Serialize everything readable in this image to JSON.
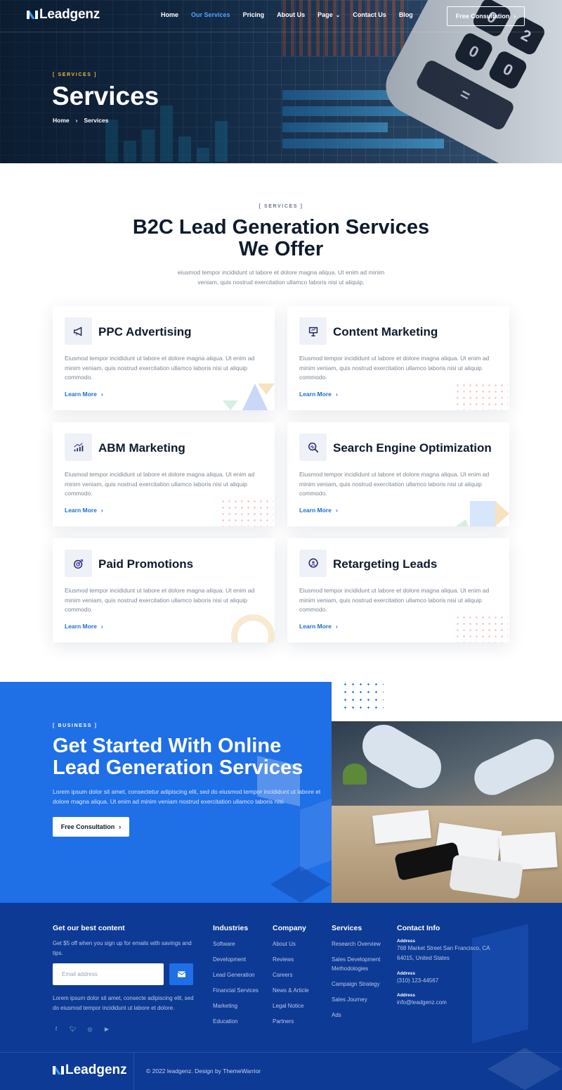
{
  "brand": {
    "logo_text": "Leadgenz"
  },
  "nav": {
    "links": [
      "Home",
      "Our Services",
      "Pricing",
      "About Us",
      "Page",
      "Contact Us",
      "Blog"
    ],
    "active": "Our Services",
    "cta": "Free Consultation"
  },
  "hero": {
    "tag": "[ SERVICES ]",
    "title": "Services",
    "breadcrumb": [
      "Home",
      "Services"
    ]
  },
  "services_section": {
    "tag": "[ SERVICES ]",
    "title_line1": "B2C Lead Generation Services",
    "title_line2": "We Offer",
    "description": "eiusmod tempor incididunt ut labore et dolore magna aliqua. Ut enim ad minim veniam, quis nostrud exercitation ullamco laboris nisi ut aliquip.",
    "cards": [
      {
        "title": "PPC Advertising",
        "icon": "megaphone-icon",
        "text": "Eiusmod tempor incididunt ut labore et dolore magna aliqua. Ut enim ad minim veniam, quis nostrud exercitation ullamco laboris nisi ut aliquip commodo.",
        "link": "Learn More"
      },
      {
        "title": "Content Marketing",
        "icon": "presentation-icon",
        "text": "Eiusmod tempor incididunt ut labore et dolore magna aliqua. Ut enim ad minim veniam, quis nostrud exercitation ullamco laboris nisi ut aliquip commodo.",
        "link": "Learn More"
      },
      {
        "title": "ABM Marketing",
        "icon": "growth-chart-icon",
        "text": "Eiusmod tempor incididunt ut labore et dolore magna aliqua. Ut enim ad minim veniam, quis nostrud exercitation ullamco laboris nisi ut aliquip commodo.",
        "link": "Learn More"
      },
      {
        "title": "Search Engine Optimization",
        "icon": "magnifier-pulse-icon",
        "text": "Eiusmod tempor incididunt ut labore et dolore magna aliqua. Ut enim ad minim veniam, quis nostrud exercitation ullamco laboris nisi ut aliquip commodo.",
        "link": "Learn More"
      },
      {
        "title": "Paid Promotions",
        "icon": "target-icon",
        "text": "Eiusmod tempor incididunt ut labore et dolore magna aliqua. Ut enim ad minim veniam, quis nostrud exercitation ullamco laboris nisi ut aliquip commodo.",
        "link": "Learn More"
      },
      {
        "title": "Retargeting Leads",
        "icon": "user-target-icon",
        "text": "Eiusmod tempor incididunt ut labore et dolore magna aliqua. Ut enim ad minim veniam, quis nostrud exercitation ullamco laboris nisi ut aliquip commodo.",
        "link": "Learn More"
      }
    ]
  },
  "business": {
    "tag": "[ BUSINESS ]",
    "title_line1": "Get Started With Online",
    "title_line2": "Lead Generation Services",
    "text": "Lorem ipsum dolor sit amet, consectetur adipiscing elit, sed do eiusmod tempor incididunt ut labore et dolore magna aliqua. Ut enim ad minim veniam nostrud exercitation ullamco laboris nisi.",
    "button": "Free Consultation"
  },
  "footer": {
    "newsletter": {
      "heading": "Get our best content",
      "subtext": "Get $5 off when you sign up for emails with savings and tips.",
      "email_placeholder": "Email address",
      "about": "Lorem ipsum dolor sit amet, consecte adipiscing elit, sed do eiusmod tempor incididunt ut labore et dolore."
    },
    "industries": {
      "heading": "Industries",
      "items": [
        "Software",
        "Development",
        "Lead Generation",
        "Financial Services",
        "Marketing",
        "Education"
      ]
    },
    "company": {
      "heading": "Company",
      "items": [
        "About Us",
        "Reviews",
        "Careers",
        "News & Article",
        "Legal Notice",
        "Partners"
      ]
    },
    "services": {
      "heading": "Services",
      "items": [
        "Research Overview",
        "Sales Development Methodologies",
        "Campaign Strategy",
        "Sales Journey",
        "Ads"
      ]
    },
    "contact": {
      "heading": "Contact Info",
      "address_label": "Address",
      "address": "768 Market Street San Francisco, CA 64015, United States",
      "phone_label": "Address",
      "phone": "(310) 123-44567",
      "email_label": "Address",
      "email": "info@leadgenz.com"
    },
    "social_icons": [
      "facebook-icon",
      "twitter-icon",
      "instagram-icon",
      "youtube-icon"
    ],
    "logo_text": "Leadgenz",
    "copyright": "© 2022 leadgenz. Design by ThemeWarrior"
  },
  "colors": {
    "primary": "#1f6fe6",
    "footer_bg": "#0d3a94",
    "accent_yellow": "#f2b833",
    "link_blue": "#1a6ed8",
    "dark_text": "#0f1b2d"
  }
}
